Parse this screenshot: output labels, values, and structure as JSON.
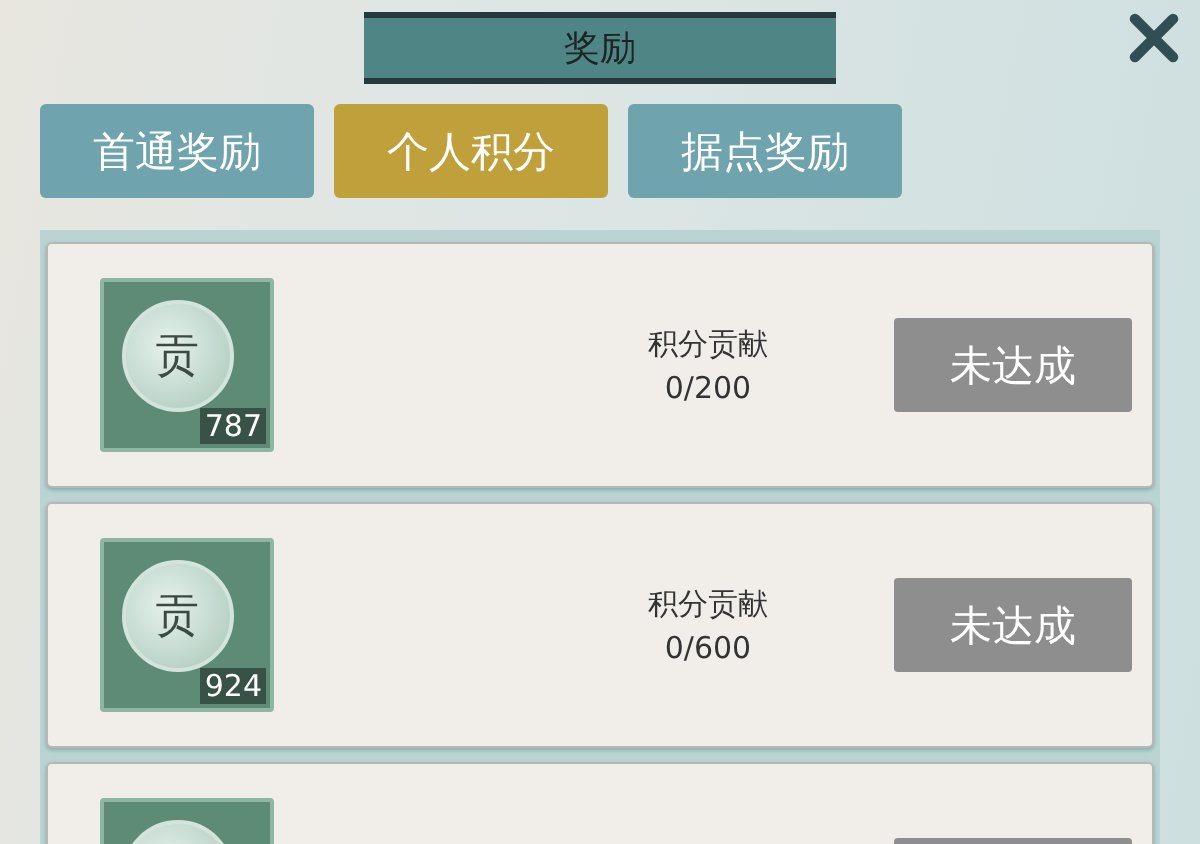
{
  "window": {
    "title": "奖励"
  },
  "tabs": [
    {
      "label": "首通奖励",
      "selected": false
    },
    {
      "label": "个人积分",
      "selected": true
    },
    {
      "label": "据点奖励",
      "selected": false
    }
  ],
  "rewards": [
    {
      "emblem": "贡",
      "count": "787",
      "label": "积分贡献",
      "progress": "0/200",
      "button": "未达成",
      "achieved": false
    },
    {
      "emblem": "贡",
      "count": "924",
      "label": "积分贡献",
      "progress": "0/600",
      "button": "未达成",
      "achieved": false
    },
    {
      "achieved": false
    }
  ]
}
